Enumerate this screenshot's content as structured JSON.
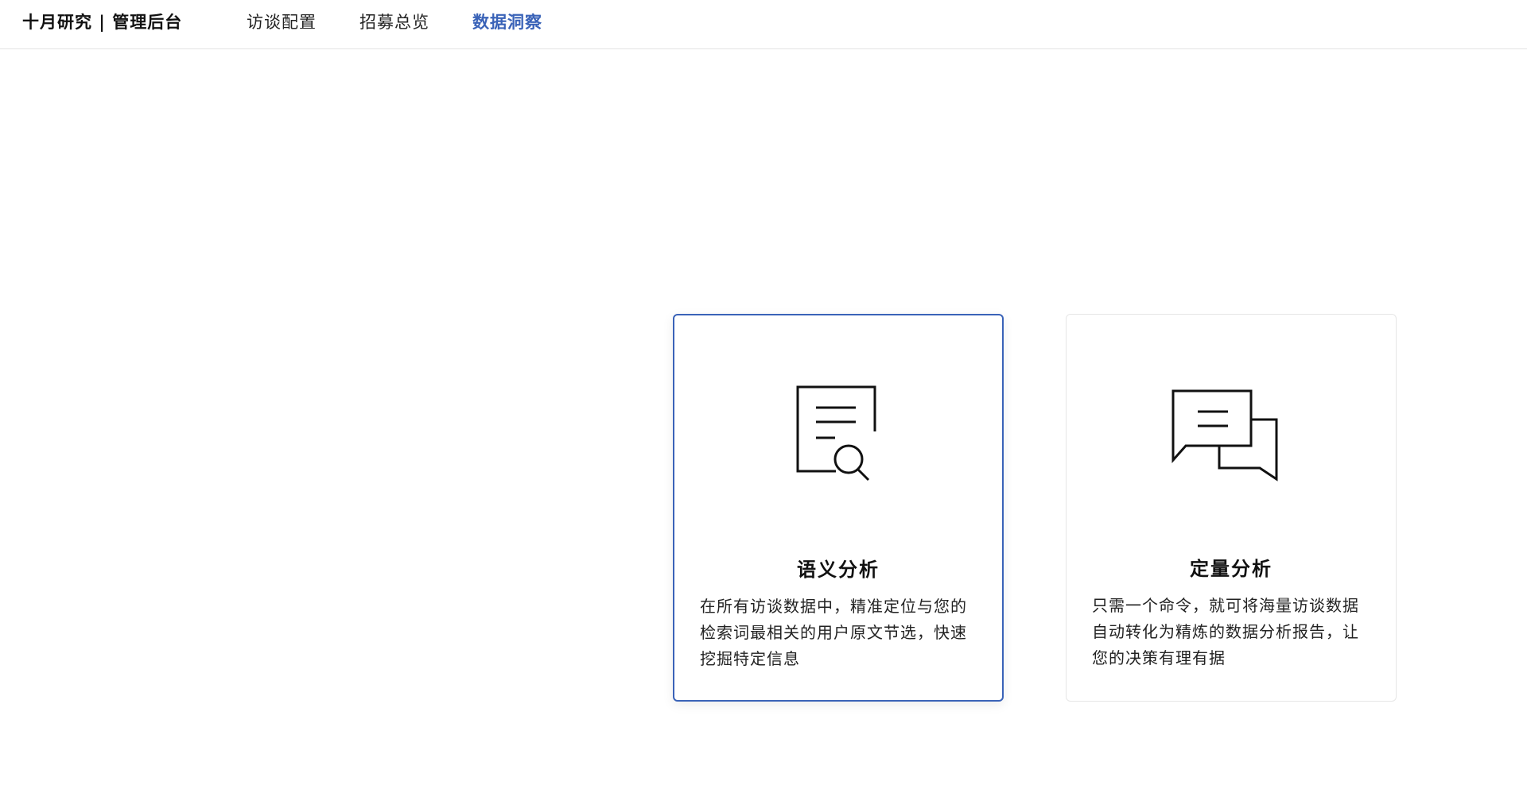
{
  "header": {
    "brand": "十月研究 | 管理后台",
    "nav": [
      {
        "label": "访谈配置",
        "active": false
      },
      {
        "label": "招募总览",
        "active": false
      },
      {
        "label": "数据洞察",
        "active": true
      }
    ]
  },
  "cards": [
    {
      "icon": "document-search-icon",
      "title": "语义分析",
      "description": "在所有访谈数据中，精准定位与您的检索词最相关的用户原文节选，快速挖掘特定信息",
      "selected": true
    },
    {
      "icon": "chat-bubbles-icon",
      "title": "定量分析",
      "description": "只需一个命令，就可将海量访谈数据自动转化为精炼的数据分析报告，让您的决策有理有据",
      "selected": false
    }
  ],
  "colors": {
    "accent": "#3a63b8",
    "border": "#e6e6e6",
    "text": "#111111"
  }
}
